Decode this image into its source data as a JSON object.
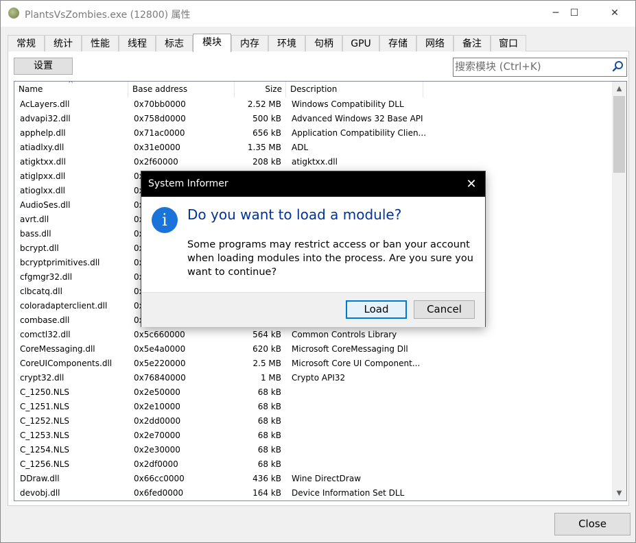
{
  "window": {
    "title": "PlantsVsZombies.exe (12800) 属性",
    "minimize_glyph": "─",
    "maximize_glyph": "☐",
    "close_glyph": "✕"
  },
  "tabs": [
    {
      "label": "常规"
    },
    {
      "label": "统计"
    },
    {
      "label": "性能"
    },
    {
      "label": "线程"
    },
    {
      "label": "标志"
    },
    {
      "label": "模块"
    },
    {
      "label": "内存"
    },
    {
      "label": "环境"
    },
    {
      "label": "句柄"
    },
    {
      "label": "GPU"
    },
    {
      "label": "存储"
    },
    {
      "label": "网络"
    },
    {
      "label": "备注"
    },
    {
      "label": "窗口"
    }
  ],
  "active_tab": "模块",
  "toolbar": {
    "settings_label": "设置",
    "search_placeholder": "搜索模块 (Ctrl+K)"
  },
  "columns": {
    "name": "Name",
    "base": "Base address",
    "size": "Size",
    "desc": "Description"
  },
  "modules": [
    {
      "name": "AcLayers.dll",
      "base": "0x70bb0000",
      "size": "2.52 MB",
      "desc": "Windows Compatibility DLL"
    },
    {
      "name": "advapi32.dll",
      "base": "0x758d0000",
      "size": "500 kB",
      "desc": "Advanced Windows 32 Base API"
    },
    {
      "name": "apphelp.dll",
      "base": "0x71ac0000",
      "size": "656 kB",
      "desc": "Application Compatibility Clien..."
    },
    {
      "name": "atiadlxy.dll",
      "base": "0x31e0000",
      "size": "1.35 MB",
      "desc": "ADL"
    },
    {
      "name": "atigktxx.dll",
      "base": "0x2f60000",
      "size": "208 kB",
      "desc": "atigktxx.dll"
    },
    {
      "name": "atiglpxx.dll",
      "base": "0x",
      "size": "",
      "desc": ""
    },
    {
      "name": "atioglxx.dll",
      "base": "0x",
      "size": "",
      "desc": ""
    },
    {
      "name": "AudioSes.dll",
      "base": "0x",
      "size": "",
      "desc": ""
    },
    {
      "name": "avrt.dll",
      "base": "0x",
      "size": "",
      "desc": ""
    },
    {
      "name": "bass.dll",
      "base": "0x",
      "size": "",
      "desc": ""
    },
    {
      "name": "bcrypt.dll",
      "base": "0x",
      "size": "",
      "desc": ""
    },
    {
      "name": "bcryptprimitives.dll",
      "base": "0x",
      "size": "",
      "desc": ""
    },
    {
      "name": "cfgmgr32.dll",
      "base": "0x",
      "size": "",
      "desc": ""
    },
    {
      "name": "clbcatq.dll",
      "base": "0x",
      "size": "",
      "desc": ""
    },
    {
      "name": "coloradapterclient.dll",
      "base": "0x",
      "size": "",
      "desc": ""
    },
    {
      "name": "combase.dll",
      "base": "0x",
      "size": "",
      "desc": ""
    },
    {
      "name": "comctl32.dll",
      "base": "0x5c660000",
      "size": "564 kB",
      "desc": "Common Controls Library"
    },
    {
      "name": "CoreMessaging.dll",
      "base": "0x5e4a0000",
      "size": "620 kB",
      "desc": "Microsoft CoreMessaging Dll"
    },
    {
      "name": "CoreUIComponents.dll",
      "base": "0x5e220000",
      "size": "2.5 MB",
      "desc": "Microsoft Core UI Component..."
    },
    {
      "name": "crypt32.dll",
      "base": "0x76840000",
      "size": "1 MB",
      "desc": "Crypto API32"
    },
    {
      "name": "C_1250.NLS",
      "base": "0x2e50000",
      "size": "68 kB",
      "desc": ""
    },
    {
      "name": "C_1251.NLS",
      "base": "0x2e10000",
      "size": "68 kB",
      "desc": ""
    },
    {
      "name": "C_1252.NLS",
      "base": "0x2dd0000",
      "size": "68 kB",
      "desc": ""
    },
    {
      "name": "C_1253.NLS",
      "base": "0x2e70000",
      "size": "68 kB",
      "desc": ""
    },
    {
      "name": "C_1254.NLS",
      "base": "0x2e30000",
      "size": "68 kB",
      "desc": ""
    },
    {
      "name": "C_1256.NLS",
      "base": "0x2df0000",
      "size": "68 kB",
      "desc": ""
    },
    {
      "name": "DDraw.dll",
      "base": "0x66cc0000",
      "size": "436 kB",
      "desc": "Wine DirectDraw"
    },
    {
      "name": "devobj.dll",
      "base": "0x6fed0000",
      "size": "164 kB",
      "desc": "Device Information Set DLL"
    }
  ],
  "dialog": {
    "title": "System Informer",
    "close_glyph": "✕",
    "icon": "info-icon",
    "icon_glyph": "i",
    "heading": "Do you want to load a module?",
    "message": "Some programs may restrict access or ban your account when loading modules into the process. Are you sure you want to continue?",
    "load_label": "Load",
    "cancel_label": "Cancel"
  },
  "footer": {
    "close_label": "Close"
  },
  "colors": {
    "accent": "#0078d7",
    "dialog_heading": "#003399",
    "info_icon": "#1a73d9"
  }
}
